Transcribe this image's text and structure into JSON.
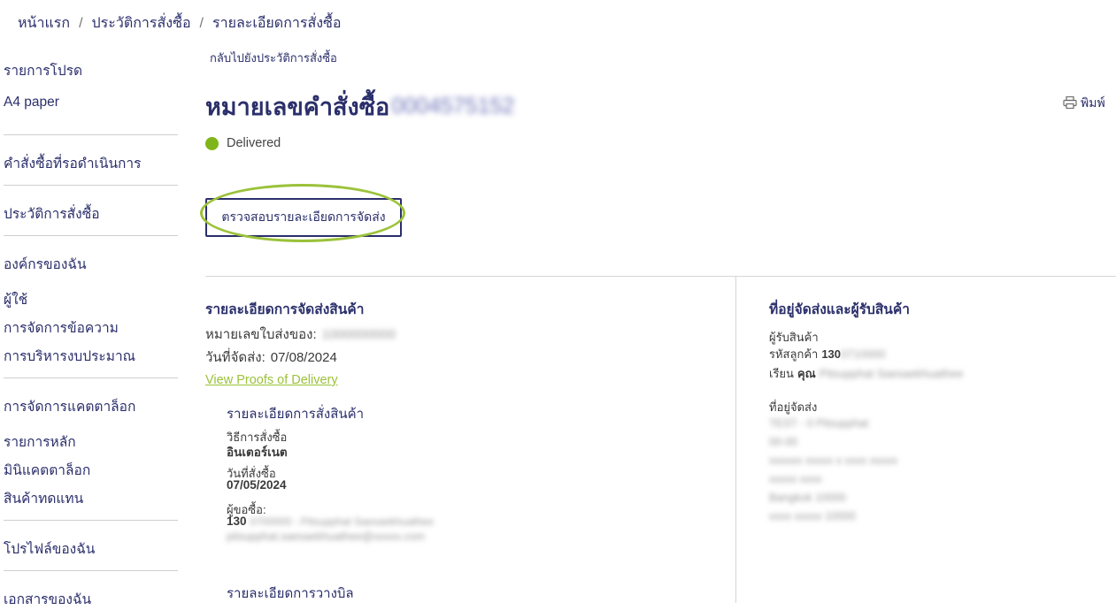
{
  "breadcrumb": {
    "home": "หน้าแรก",
    "history": "ประวัติการสั่งซื้อ",
    "current": "รายละเอียดการสั่งซื้อ",
    "sep": "/"
  },
  "sidebar": {
    "items": [
      "รายการโปรด",
      "A4 paper",
      "คำสั่งซื้อที่รอดำเนินการ",
      "ประวัติการสั่งซื้อ",
      "องค์กรของฉัน",
      "ผู้ใช้",
      "การจัดการข้อความ",
      "การบริหารงบประมาณ",
      "การจัดการแคตตาล็อก",
      "รายการหลัก",
      "มินิแคตตาล็อก",
      "สินค้าทดแทน",
      "โปรไฟล์ของฉัน",
      "เอกสารของฉัน"
    ]
  },
  "main": {
    "back_link": "กลับไปยังประวัติการสั่งซื้อ",
    "title": "หมายเลขคำสั่งซื้อ",
    "order_number": "0004575152",
    "print_label": "พิมพ์",
    "status": "Delivered",
    "status_color": "#7fb51b",
    "track_button": "ตรวจสอบรายละเอียดการจัดส่ง",
    "highlight_color": "#9bc23a"
  },
  "shipping": {
    "title": "รายละเอียดการจัดส่งสินค้า",
    "waybill_label": "หมายเลขใบส่งของ:",
    "waybill_value": "1000000000",
    "ship_date_label": "วันที่จัดส่ง:",
    "ship_date": "07/08/2024",
    "pod_link": "View Proofs of Delivery",
    "order_details": {
      "title": "รายละเอียดการสั่งสินค้า",
      "method_label": "วิธีการสั่งซื้อ",
      "method": "อินเตอร์เนต",
      "order_date_label": "วันที่สั่งซื้อ",
      "order_date": "07/05/2024",
      "buyer_label": "ผู้ขอซื้อ:",
      "buyer_id": "130",
      "buyer_id_rest": "0700000 - Pitsupphat Saesaekhuathee",
      "buyer_email": "pitsupphat.saesaekhuathee@xxxxx.com"
    },
    "billing_title": "รายละเอียดการวางบิล"
  },
  "address": {
    "title": "ที่อยู่จัดส่งและผู้รับสินค้า",
    "recipient_label": "ผู้รับสินค้า",
    "customer_code_label": "รหัสลูกค้า",
    "customer_code": "130",
    "customer_code_rest": "0710000",
    "attn_label": "เรียน",
    "attn_prefix": "คุณ",
    "attn_name": "Pitsupphat Saesaekhuathee",
    "ship_to_label": "ที่อยู่จัดส่ง",
    "lines": [
      "TEST - 0 Pitsupphat",
      "00-00",
      "xxxxxx xxxxx x xxxx xxxxx",
      "xxxxx xxxx",
      "Bangkok 10000",
      "xxxx xxxxx 10000"
    ]
  }
}
